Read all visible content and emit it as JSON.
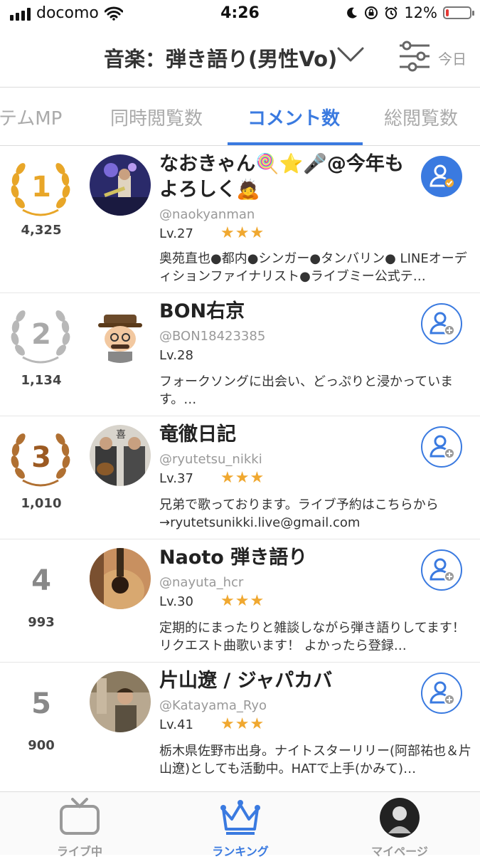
{
  "status_bar": {
    "carrier": "docomo",
    "time": "4:26",
    "battery_percent": "12%",
    "battery_level": 0.12
  },
  "header": {
    "title": "音楽：弾き語り(男性Vo)",
    "period": "今日"
  },
  "tabs": [
    {
      "label": "テムMP"
    },
    {
      "label": "同時閲覧数"
    },
    {
      "label": "コメント数",
      "active": true
    },
    {
      "label": "総閲覧数"
    }
  ],
  "ranking": [
    {
      "rank": "1",
      "count": "4,325",
      "name": "なおきゃん🍭⭐🎤@今年もよろしく🙇",
      "handle": "@naokyanman",
      "level": "Lv.27",
      "stars": "★★★",
      "description": "奥苑直也●都内●シンガー●タンバリン● LINEオーディションファイナリスト●ライブミー公式テ…",
      "follow_state": "followed"
    },
    {
      "rank": "2",
      "count": "1,134",
      "name": "BON右京",
      "handle": "@BON18423385",
      "level": "Lv.28",
      "stars": "",
      "description": "フォークソングに出会い、どっぷりと浸かっています。…",
      "follow_state": "not-followed"
    },
    {
      "rank": "3",
      "count": "1,010",
      "name": "竜徹日記",
      "handle": "@ryutetsu_nikki",
      "level": "Lv.37",
      "stars": "★★★",
      "description": "兄弟で歌っております。ライブ予約はこちらから→ryutetsunikki.live@gmail.com",
      "follow_state": "not-followed"
    },
    {
      "rank": "4",
      "count": "993",
      "name": "Naoto 弾き語り",
      "handle": "@nayuta_hcr",
      "level": "Lv.30",
      "stars": "★★★",
      "description": "定期的にまったりと雑談しながら弾き語りしてます！リクエスト曲歌います！ よかったら登録…",
      "follow_state": "not-followed"
    },
    {
      "rank": "5",
      "count": "900",
      "name": "片山遼 / ジャパカバ",
      "handle": "@Katayama_Ryo",
      "level": "Lv.41",
      "stars": "★★★",
      "description": "栃木県佐野市出身。ナイトスターリリー(阿部祐也＆片山遼)としても活動中。HATで上手(かみて)…",
      "follow_state": "not-followed"
    }
  ],
  "tabbar": [
    {
      "label": "ライブ中",
      "icon": "tv-icon"
    },
    {
      "label": "ランキング",
      "icon": "crown-icon",
      "active": true
    },
    {
      "label": "マイページ",
      "icon": "avatar-icon"
    }
  ],
  "colors": {
    "accent": "#3a7ae0",
    "gold": "#e8a628",
    "silver": "#b8b8b8",
    "bronze": "#b07032",
    "star": "#f0a830"
  }
}
